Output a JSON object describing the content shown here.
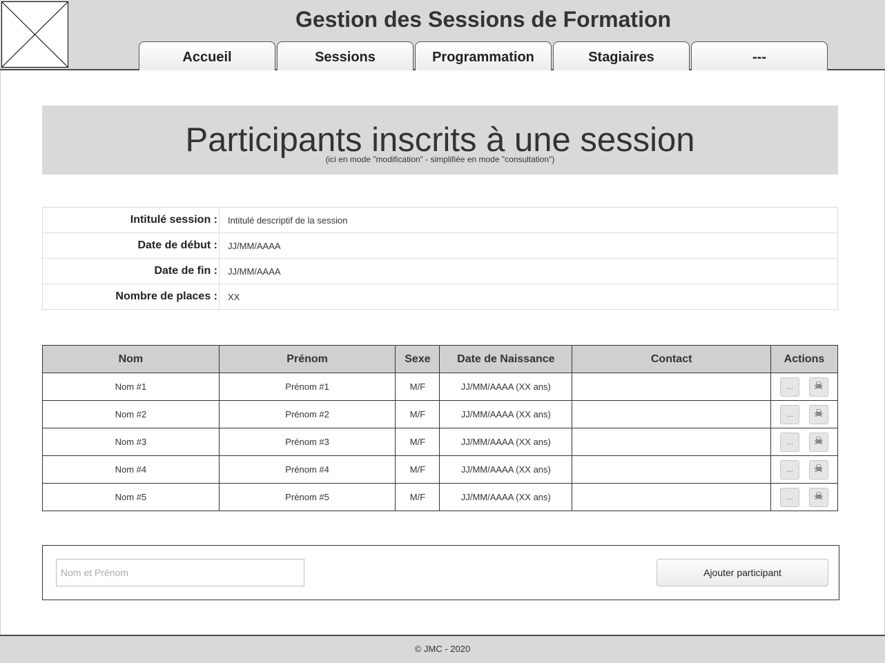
{
  "header": {
    "title": "Gestion des Sessions de Formation",
    "tabs": [
      {
        "label": "Accueil"
      },
      {
        "label": "Sessions"
      },
      {
        "label": "Programmation"
      },
      {
        "label": "Stagiaires"
      },
      {
        "label": "---"
      }
    ]
  },
  "banner": {
    "title": "Participants inscrits à une session",
    "subtitle": "(ici en mode \"modification\" - simplifiée en mode \"consultation\")"
  },
  "session_info": {
    "rows": [
      {
        "label": "Intitulé session :",
        "value": "Intitulé descriptif de la session"
      },
      {
        "label": "Date de début :",
        "value": "JJ/MM/AAAA"
      },
      {
        "label": "Date de fin :",
        "value": "JJ/MM/AAAA"
      },
      {
        "label": "Nombre de places :",
        "value": "XX"
      }
    ]
  },
  "participants": {
    "headers": [
      "Nom",
      "Prénom",
      "Sexe",
      "Date de Naissance",
      "Contact",
      "Actions"
    ],
    "rows": [
      {
        "nom": "Nom #1",
        "prenom": "Prénom #1",
        "sexe": "M/F",
        "naissance": "JJ/MM/AAAA (XX ans)",
        "contact": ""
      },
      {
        "nom": "Nom #2",
        "prenom": "Prénom #2",
        "sexe": "M/F",
        "naissance": "JJ/MM/AAAA (XX ans)",
        "contact": ""
      },
      {
        "nom": "Nom #3",
        "prenom": "Prénom #3",
        "sexe": "M/F",
        "naissance": "JJ/MM/AAAA (XX ans)",
        "contact": ""
      },
      {
        "nom": "Nom #4",
        "prenom": "Prénom #4",
        "sexe": "M/F",
        "naissance": "JJ/MM/AAAA (XX ans)",
        "contact": ""
      },
      {
        "nom": "Nom #5",
        "prenom": "Prénom #5",
        "sexe": "M/F",
        "naissance": "JJ/MM/AAAA (XX ans)",
        "contact": ""
      }
    ],
    "edit_label": "...",
    "delete_glyph": "☠",
    "icons": {
      "edit": "ellipsis-icon",
      "delete": "skull-icon"
    }
  },
  "add_form": {
    "placeholder": "Nom et Prénom",
    "button_label": "Ajouter participant"
  },
  "footer": {
    "text": "© JMC - 2020"
  },
  "colors": {
    "header_bg": "#d9d9d9",
    "table_header_bg": "#d0d0d0",
    "border_dark": "#333333"
  }
}
